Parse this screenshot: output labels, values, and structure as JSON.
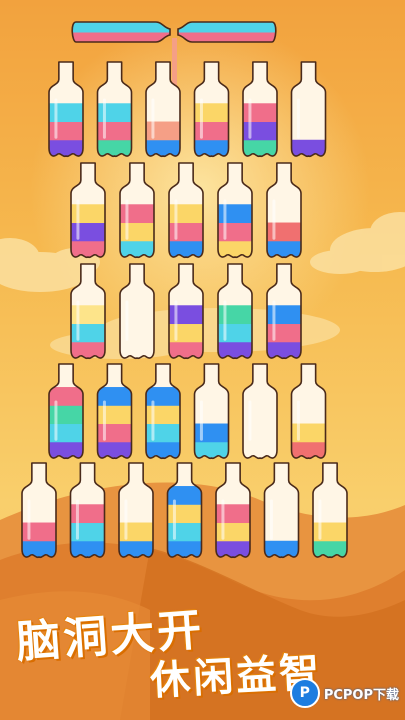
{
  "game": {
    "colors": {
      "orange": "#f59f86",
      "pink": "#f06e8a",
      "purple": "#7a4ee0",
      "blue": "#2f90f2",
      "cyan": "#4fd3e8",
      "green": "#46d6a6",
      "yellow": "#fbd667",
      "lightyellow": "#fde48a",
      "red": "#f07070",
      "empty": "#fff6e6"
    },
    "pouring_bottles": [
      {
        "layers": [
          "pink",
          "cyan"
        ]
      },
      {
        "layers": [
          "pink",
          "cyan"
        ]
      }
    ],
    "rows": [
      [
        {
          "layers": [
            "purple",
            "pink",
            "cyan"
          ]
        },
        {
          "layers": [
            "green",
            "pink",
            "cyan"
          ]
        },
        {
          "layers": [
            "blue",
            "orange"
          ]
        },
        {
          "layers": [
            "blue",
            "pink",
            "yellow"
          ]
        },
        {
          "layers": [
            "green",
            "purple",
            "pink"
          ]
        },
        {
          "layers": [
            "purple"
          ]
        }
      ],
      [
        {
          "layers": [
            "pink",
            "purple",
            "yellow"
          ]
        },
        {
          "layers": [
            "cyan",
            "yellow",
            "pink"
          ]
        },
        {
          "layers": [
            "blue",
            "pink",
            "yellow"
          ]
        },
        {
          "layers": [
            "yellow",
            "pink",
            "blue"
          ]
        },
        {
          "layers": [
            "blue",
            "red"
          ]
        }
      ],
      [
        {
          "layers": [
            "pink",
            "cyan",
            "lightyellow"
          ]
        },
        {
          "layers": [
            "empty"
          ]
        },
        {
          "layers": [
            "pink",
            "yellow",
            "purple"
          ]
        },
        {
          "layers": [
            "purple",
            "cyan",
            "green"
          ]
        },
        {
          "layers": [
            "purple",
            "pink",
            "blue"
          ]
        }
      ],
      [
        {
          "layers": [
            "purple",
            "cyan",
            "green",
            "pink"
          ]
        },
        {
          "layers": [
            "purple",
            "pink",
            "yellow",
            "blue"
          ]
        },
        {
          "layers": [
            "blue",
            "cyan",
            "yellow",
            "blue"
          ]
        },
        {
          "layers": [
            "cyan",
            "blue"
          ]
        },
        {
          "layers": []
        },
        {
          "layers": [
            "red",
            "yellow"
          ]
        }
      ],
      [
        {
          "layers": [
            "blue",
            "pink"
          ]
        },
        {
          "layers": [
            "blue",
            "cyan",
            "pink"
          ]
        },
        {
          "layers": [
            "blue",
            "yellow"
          ]
        },
        {
          "layers": [
            "blue",
            "cyan",
            "yellow",
            "blue"
          ]
        },
        {
          "layers": [
            "purple",
            "yellow",
            "pink"
          ]
        },
        {
          "layers": [
            "blue"
          ]
        },
        {
          "layers": [
            "green",
            "yellow"
          ]
        }
      ]
    ]
  },
  "slogan": {
    "line1": "脑洞大开",
    "line2": "休闲益智"
  },
  "watermark": {
    "logo_letter": "P",
    "text": "PCPOP下载"
  }
}
